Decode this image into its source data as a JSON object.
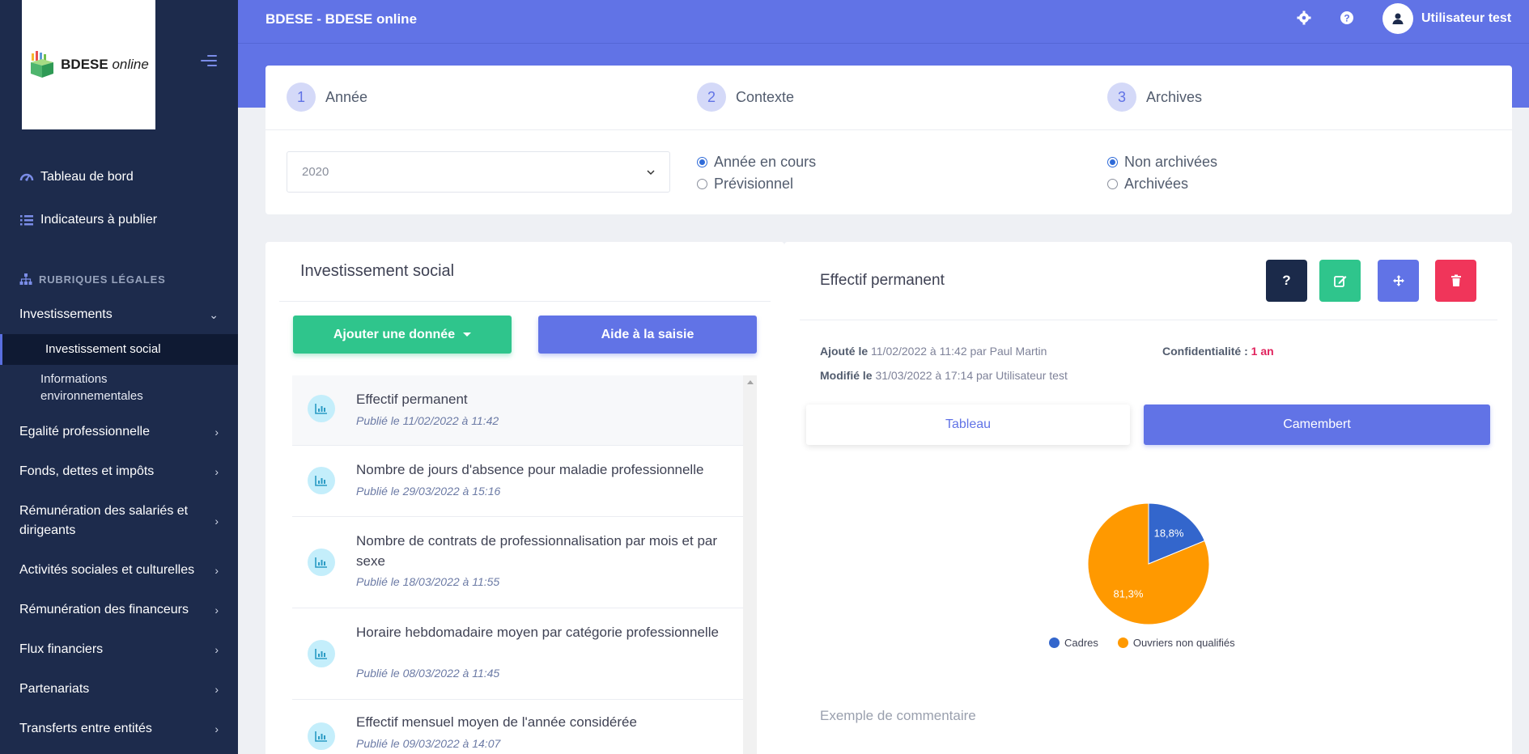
{
  "sidebar": {
    "logo_main": "BDESE",
    "logo_sub": "online",
    "top_items": [
      {
        "label": "Tableau de bord",
        "icon": "dashboard-icon"
      },
      {
        "label": "Indicateurs à publier",
        "icon": "list-icon"
      }
    ],
    "section_title": "RUBRIQUES LÉGALES",
    "investissements": {
      "label": "Investissements",
      "expanded": true
    },
    "sub_items": {
      "active": "Investissement social",
      "other": "Informations environnementales"
    },
    "items": [
      "Egalité professionnelle",
      "Fonds, dettes et impôts",
      "Rémunération des salariés et dirigeants",
      "Activités sociales et culturelles",
      "Rémunération des financeurs",
      "Flux financiers",
      "Partenariats",
      "Transferts entre entités"
    ]
  },
  "header": {
    "title": "BDESE - BDESE online",
    "user_name": "Utilisateur test"
  },
  "steps": [
    {
      "num": "1",
      "label": "Année"
    },
    {
      "num": "2",
      "label": "Contexte"
    },
    {
      "num": "3",
      "label": "Archives"
    }
  ],
  "filters": {
    "year_value": "2020",
    "context_options": [
      {
        "label": "Année en cours",
        "checked": true
      },
      {
        "label": "Prévisionnel",
        "checked": false
      }
    ],
    "archive_options": [
      {
        "label": "Non archivées",
        "checked": true
      },
      {
        "label": "Archivées",
        "checked": false
      }
    ]
  },
  "left_panel": {
    "title": "Investissement social",
    "add_button": "Ajouter une donnée",
    "help_button": "Aide à la saisie",
    "items": [
      {
        "title": "Effectif permanent",
        "date": "Publié le 11/02/2022 à 11:42"
      },
      {
        "title": "Nombre de jours d'absence pour maladie professionnelle",
        "date": "Publié le 29/03/2022 à 15:16"
      },
      {
        "title": "Nombre de contrats de professionnalisation par mois et par sexe",
        "date": "Publié le 18/03/2022 à 11:55"
      },
      {
        "title": "Horaire hebdomadaire moyen par catégorie professionnelle",
        "date": "Publié le 08/03/2022 à 11:45"
      },
      {
        "title": "Effectif mensuel moyen de l'année considérée",
        "date": "Publié le 09/03/2022 à 14:07"
      }
    ]
  },
  "right_panel": {
    "title": "Effectif permanent",
    "added_label": "Ajouté le",
    "added_value": "11/02/2022 à 11:42 par Paul Martin",
    "modified_label": "Modifié le",
    "modified_value": "31/03/2022 à 17:14 par Utilisateur test",
    "confidentiality_label": "Confidentialité :",
    "confidentiality_value": "1 an",
    "tab_table": "Tableau",
    "tab_pie": "Camembert",
    "comment": "Exemple de commentaire",
    "colors": {
      "help": "#1b2a4a",
      "edit": "#2fc58c",
      "move": "#6173e6",
      "delete": "#f0355a"
    }
  },
  "chart_data": {
    "type": "pie",
    "slices": [
      {
        "label": "Cadres",
        "value": 18.8,
        "display": "18,8%",
        "color": "#3366cc"
      },
      {
        "label": "Ouvriers non qualifiés",
        "value": 81.3,
        "display": "81,3%",
        "color": "#ff9900"
      }
    ],
    "legend_position": "bottom"
  }
}
